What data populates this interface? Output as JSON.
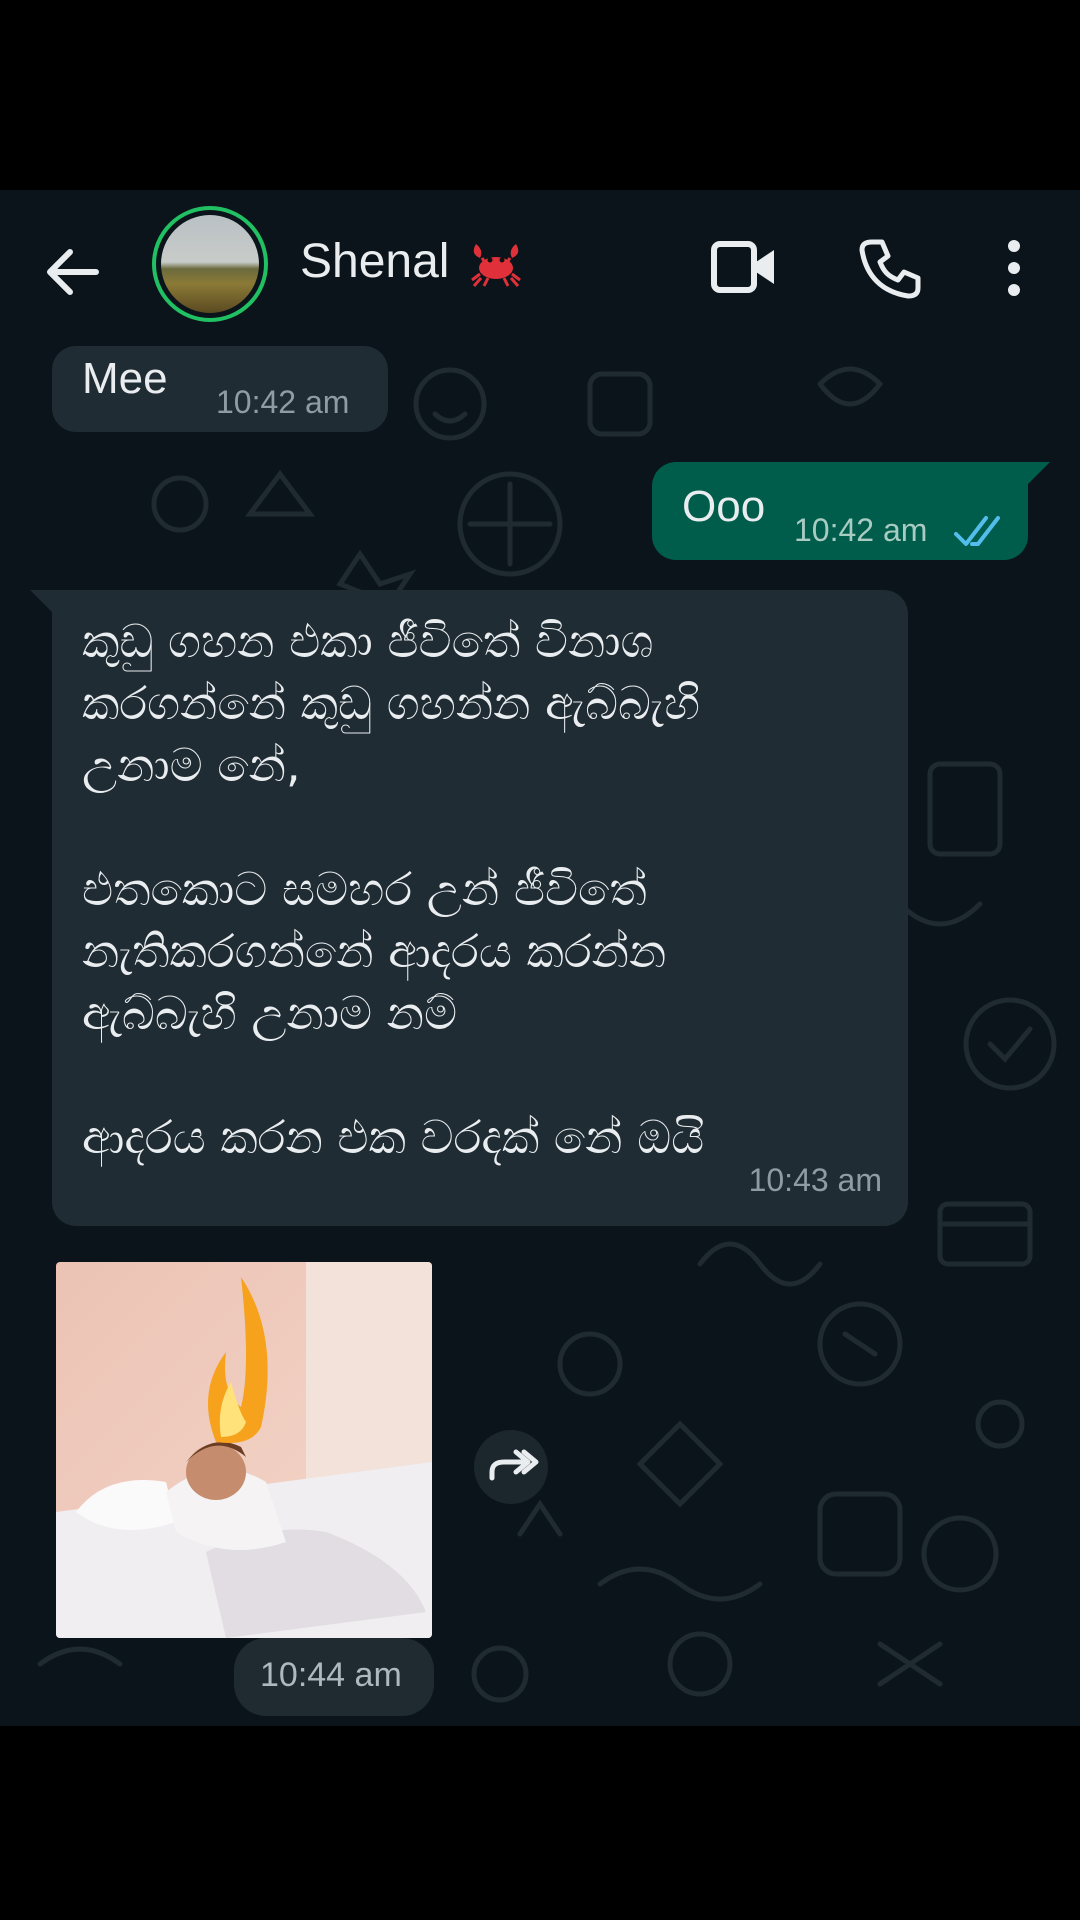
{
  "header": {
    "contact_name": "Shenal",
    "contact_emoji": "crab-emoji",
    "back_icon": "arrow-left-icon",
    "video_icon": "video-call-icon",
    "call_icon": "phone-icon",
    "menu_icon": "more-vertical-icon",
    "avatar_ring_color": "#21c063"
  },
  "messages": [
    {
      "direction": "incoming",
      "text": "Mee",
      "time": "10:42 am"
    },
    {
      "direction": "outgoing",
      "text": "Ooo",
      "time": "10:42 am",
      "status": "read-double-tick",
      "tick_color": "#53bdeb"
    },
    {
      "direction": "incoming",
      "lines": [
        "කුඩු ගහන එකා ජීවිතේ විනාශ",
        "කරගන්නේ කුඩු ගහන්න ඇබ්බැහි",
        "උනාම නේ,",
        "",
        "එතකොට සමහර උන් ජීවිතේ",
        "නැතිකරගන්නේ ආදරය කරන්න",
        "ඇබ්බැහි උනාම නම්",
        "",
        "ආදරය කරන එක වරදක් නේ ඔයි"
      ],
      "time": "10:43 am"
    },
    {
      "direction": "incoming",
      "type": "image",
      "time": "10:44 am",
      "forward_icon": "forward-icon"
    }
  ],
  "colors": {
    "chat_bg": "#0b141a",
    "incoming_bubble": "#202c33",
    "outgoing_bubble": "#005c4b"
  }
}
